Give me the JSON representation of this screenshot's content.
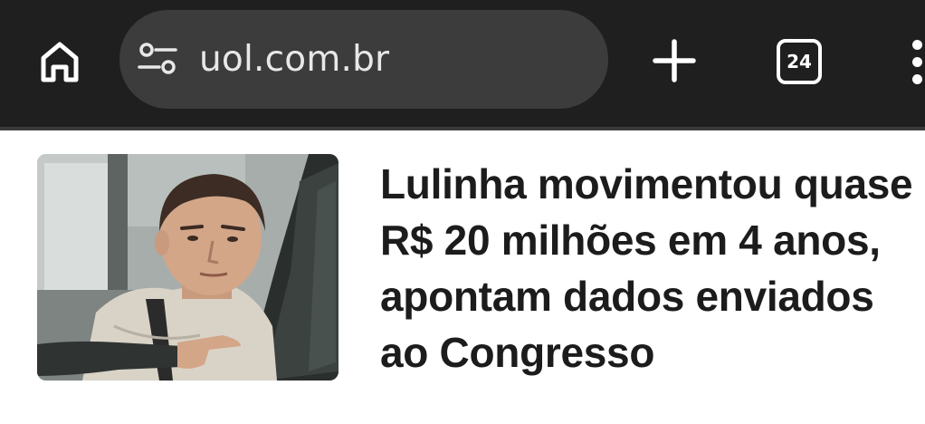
{
  "browser": {
    "url": "uol.com.br",
    "tab_count": "24"
  },
  "article": {
    "headline": "Lulinha movimentou quase\nR$ 20 milhões em 4 anos,\napontam dados enviados\nao Congresso"
  }
}
